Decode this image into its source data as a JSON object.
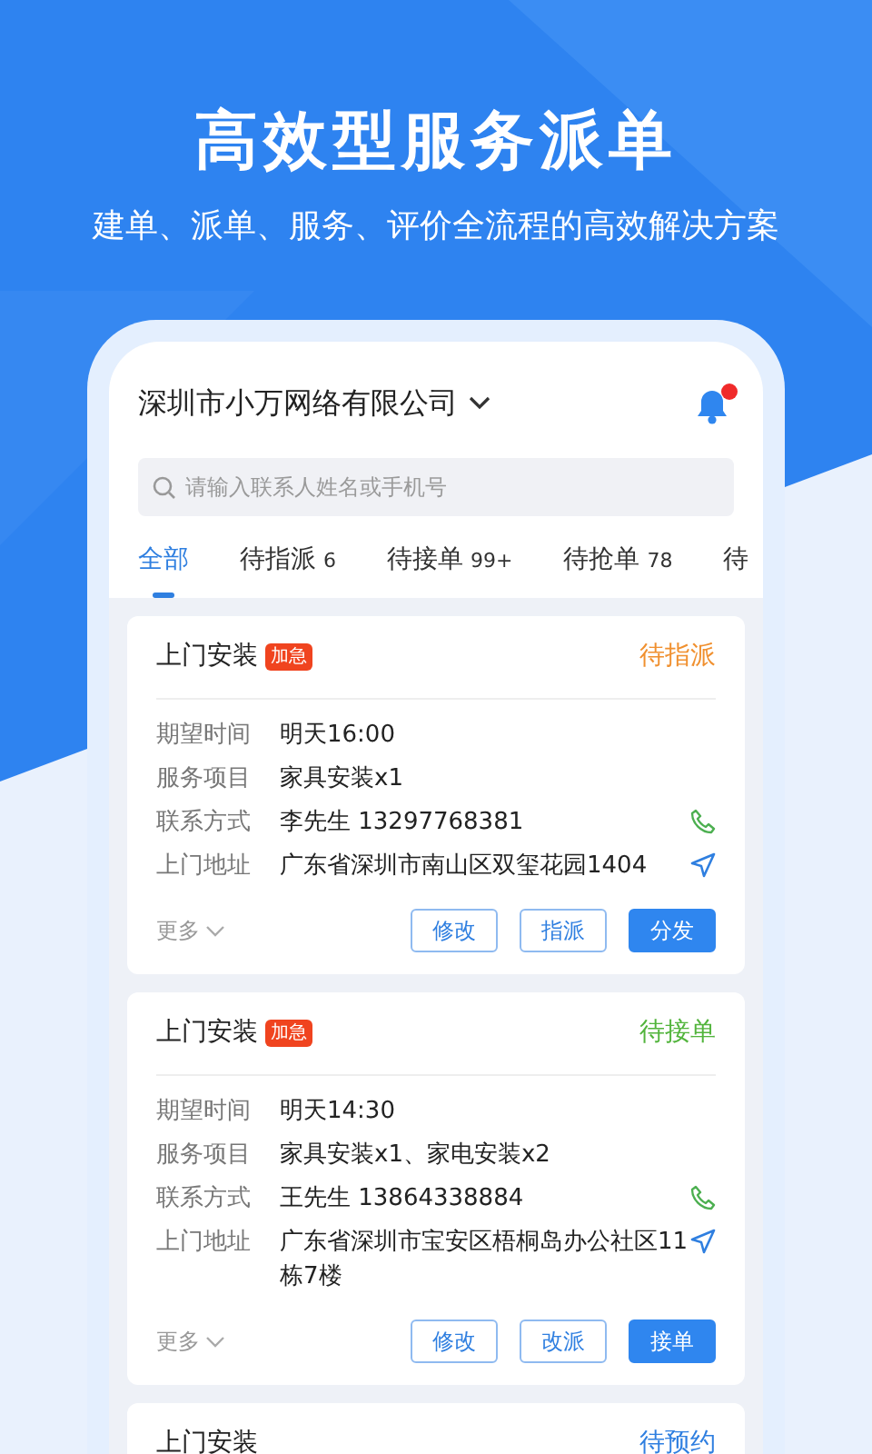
{
  "headline": "高效型服务派单",
  "subtitle": "建单、派单、服务、评价全流程的高效解决方案",
  "company": "深圳市小万网络有限公司",
  "notifications": {
    "unread": true
  },
  "search": {
    "placeholder": "请输入联系人姓名或手机号"
  },
  "tabs": [
    {
      "label": "全部",
      "selected": true
    },
    {
      "label": "待指派",
      "count": "6",
      "selected": false
    },
    {
      "label": "待接单",
      "count": "99+",
      "selected": false
    },
    {
      "label": "待抢单",
      "count": "78",
      "selected": false
    },
    {
      "label": "待",
      "selected": false
    }
  ],
  "orders": [
    {
      "title": "上门安装",
      "badge": "加急",
      "status": "待指派",
      "color": "#f0902f",
      "fields": [
        {
          "label": "期望时间",
          "value": "明天16:00"
        },
        {
          "label": "服务项目",
          "value": "家具安装x1"
        },
        {
          "label": "联系方式",
          "value": "李先生 13297768381",
          "kind": "phone"
        },
        {
          "label": "上门地址",
          "value": "广东省深圳市南山区双玺花园1404",
          "kind": "address"
        }
      ],
      "more": "更多",
      "buttons": [
        {
          "label": "修改",
          "kind": "outline"
        },
        {
          "label": "指派",
          "kind": "outline"
        },
        {
          "label": "分发",
          "kind": "filled"
        }
      ]
    },
    {
      "title": "上门安装",
      "badge": "加急",
      "status": "待接单",
      "color": "#52b43c",
      "fields": [
        {
          "label": "期望时间",
          "value": "明天14:30"
        },
        {
          "label": "服务项目",
          "value": "家具安装x1、家电安装x2"
        },
        {
          "label": "联系方式",
          "value": "王先生 13864338884",
          "kind": "phone"
        },
        {
          "label": "上门地址",
          "value": "广东省深圳市宝安区梧桐岛办公社区11栋7楼",
          "kind": "address"
        }
      ],
      "more": "更多",
      "buttons": [
        {
          "label": "修改",
          "kind": "outline"
        },
        {
          "label": "改派",
          "kind": "outline"
        },
        {
          "label": "接单",
          "kind": "filled"
        }
      ]
    },
    {
      "title": "上门安装",
      "status": "待预约",
      "color": "#2f7fe0"
    }
  ]
}
